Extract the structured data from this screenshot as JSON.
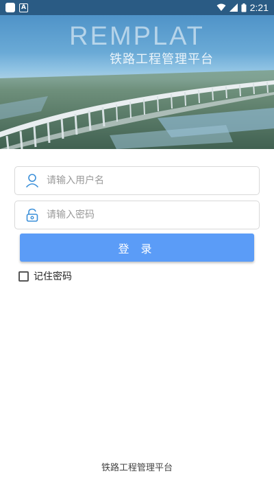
{
  "status_bar": {
    "time": "2:21"
  },
  "banner": {
    "brand": "REMPLAT",
    "subtitle": "铁路工程管理平台"
  },
  "form": {
    "username_placeholder": "请输入用户名",
    "password_placeholder": "请输入密码",
    "login_label": "登 录",
    "remember_label": "记住密码",
    "remember_checked": false
  },
  "footer": {
    "text": "铁路工程管理平台"
  },
  "colors": {
    "primary": "#5b9cf7",
    "status_bar": "#2a5b84",
    "icon": "#3a8fd9"
  },
  "icons": {
    "username": "user-icon",
    "password": "lock-icon"
  }
}
